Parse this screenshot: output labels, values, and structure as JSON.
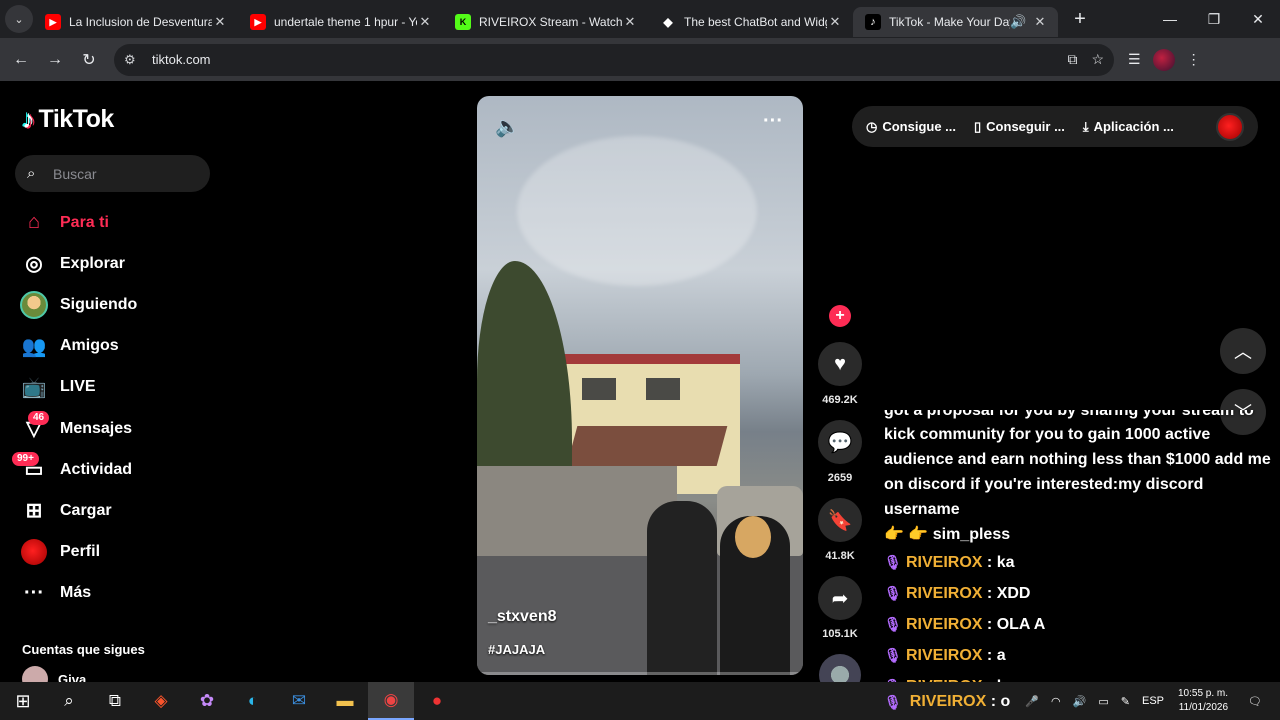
{
  "browser": {
    "tabs": [
      {
        "title": "La Inclusion de Desventura (",
        "icon": "youtube-icon",
        "active": false
      },
      {
        "title": "undertale theme 1 hpur - Yo",
        "icon": "youtube-icon",
        "active": false
      },
      {
        "title": "RIVEIROX Stream - Watch Li",
        "icon": "kick-icon",
        "active": false
      },
      {
        "title": "The best ChatBot and Widg",
        "icon": "streamelements-icon",
        "active": false
      },
      {
        "title": "TikTok - Make Your Day",
        "icon": "tiktok-icon",
        "active": true
      }
    ],
    "url": "tiktok.com"
  },
  "tiktok": {
    "logo": "TikTok",
    "search_placeholder": "Buscar",
    "nav": [
      {
        "label": "Para ti",
        "icon": "home-icon",
        "active": true
      },
      {
        "label": "Explorar",
        "icon": "compass-icon"
      },
      {
        "label": "Siguiendo",
        "icon": "following-avatar-icon"
      },
      {
        "label": "Amigos",
        "icon": "friends-icon"
      },
      {
        "label": "LIVE",
        "icon": "live-tv-icon"
      },
      {
        "label": "Mensajes",
        "icon": "messages-icon",
        "badge": "46"
      },
      {
        "label": "Actividad",
        "icon": "activity-icon",
        "badge": "99+"
      },
      {
        "label": "Cargar",
        "icon": "upload-icon"
      },
      {
        "label": "Perfil",
        "icon": "profile-avatar-icon"
      },
      {
        "label": "Más",
        "icon": "more-icon"
      }
    ],
    "following_header": "Cuentas que sigues",
    "following_first": "Giva",
    "top_actions": [
      {
        "label": "Consigue ...",
        "icon": "coin-icon"
      },
      {
        "label": "Conseguir ...",
        "icon": "phone-icon"
      },
      {
        "label": "Aplicación ...",
        "icon": "download-icon"
      }
    ],
    "video": {
      "username": "_stxven8",
      "hashtag": "#JAJAJA"
    },
    "counts": {
      "likes": "469.2K",
      "comments": "2659",
      "saves": "41.8K",
      "shares": "105.1K"
    }
  },
  "chat": {
    "partial_top": "got a proposal for you by sharing your stream to",
    "proposal_rest": "kick community for you to gain 1000 active audience and earn nothing less than $1000 add me on discord if you're interested:my discord username",
    "proposal_tail": "👉 👉  sim_pless",
    "messages": [
      {
        "user": "RIVEIROX",
        "text": ": ka"
      },
      {
        "user": "RIVEIROX",
        "text": ": XDD"
      },
      {
        "user": "RIVEIROX",
        "text": ": OLA A"
      },
      {
        "user": "RIVEIROX",
        "text": ": a"
      },
      {
        "user": "RIVEIROX",
        "text": ": k"
      }
    ],
    "tail_user": "RIVEIROX",
    "tail_text": ": o"
  },
  "taskbar": {
    "lang": "ESP",
    "time": "10:55 p. m.",
    "date": "11/01/2026"
  }
}
